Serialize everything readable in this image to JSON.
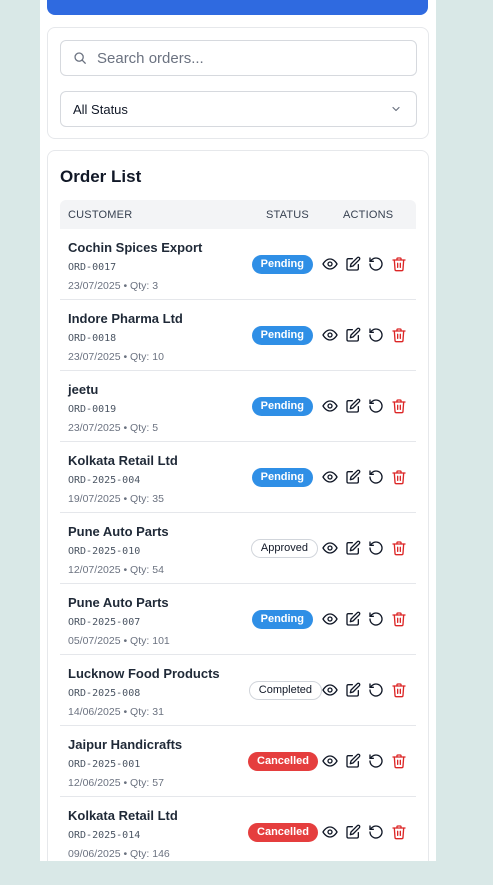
{
  "filters": {
    "search_placeholder": "Search orders...",
    "status_selected": "All Status"
  },
  "order_list": {
    "title": "Order List",
    "columns": {
      "customer": "CUSTOMER",
      "status": "STATUS",
      "actions": "ACTIONS"
    },
    "rows": [
      {
        "customer": "Cochin Spices Export",
        "id": "ORD-0017",
        "meta": "23/07/2025 • Qty: 3",
        "status": "Pending"
      },
      {
        "customer": "Indore Pharma Ltd",
        "id": "ORD-0018",
        "meta": "23/07/2025 • Qty: 10",
        "status": "Pending"
      },
      {
        "customer": "jeetu",
        "id": "ORD-0019",
        "meta": "23/07/2025 • Qty: 5",
        "status": "Pending"
      },
      {
        "customer": "Kolkata Retail Ltd",
        "id": "ORD-2025-004",
        "meta": "19/07/2025 • Qty: 35",
        "status": "Pending"
      },
      {
        "customer": "Pune Auto Parts",
        "id": "ORD-2025-010",
        "meta": "12/07/2025 • Qty: 54",
        "status": "Approved"
      },
      {
        "customer": "Pune Auto Parts",
        "id": "ORD-2025-007",
        "meta": "05/07/2025 • Qty: 101",
        "status": "Pending"
      },
      {
        "customer": "Lucknow Food Products",
        "id": "ORD-2025-008",
        "meta": "14/06/2025 • Qty: 31",
        "status": "Completed"
      },
      {
        "customer": "Jaipur Handicrafts",
        "id": "ORD-2025-001",
        "meta": "12/06/2025 • Qty: 57",
        "status": "Cancelled"
      },
      {
        "customer": "Kolkata Retail Ltd",
        "id": "ORD-2025-014",
        "meta": "09/06/2025 • Qty: 146",
        "status": "Cancelled"
      }
    ]
  },
  "icons": {
    "view": "eye-icon",
    "edit": "edit-icon",
    "refresh": "refresh-icon",
    "delete": "trash-icon"
  },
  "colors": {
    "accent": "#2f6ae0",
    "pending": "#2f8fe6",
    "cancelled": "#e53e3e",
    "delete": "#dc2626"
  }
}
